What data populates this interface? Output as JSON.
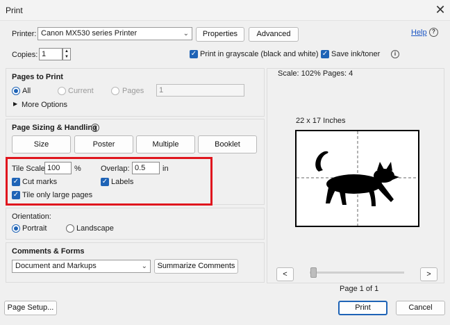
{
  "window": {
    "title": "Print"
  },
  "printer": {
    "label": "Printer:",
    "selected": "Canon MX530 series Printer",
    "properties": "Properties",
    "advanced": "Advanced",
    "help": "Help"
  },
  "copies": {
    "label": "Copies:",
    "value": "1",
    "grayscale": "Print in grayscale (black and white)",
    "save_ink": "Save ink/toner"
  },
  "pages_to_print": {
    "heading": "Pages to Print",
    "all": "All",
    "current": "Current",
    "pages": "Pages",
    "pages_value": "1",
    "more_options": "More Options"
  },
  "sizing": {
    "heading": "Page Sizing & Handling",
    "tabs": [
      "Size",
      "Poster",
      "Multiple",
      "Booklet"
    ],
    "tile_scale_label": "Tile Scale:",
    "tile_scale_value": "100",
    "tile_scale_unit": "%",
    "overlap_label": "Overlap:",
    "overlap_value": "0.5",
    "overlap_unit": "in",
    "cut_marks": "Cut marks",
    "labels": "Labels",
    "tile_large": "Tile only large pages"
  },
  "orientation": {
    "heading": "Orientation:",
    "portrait": "Portrait",
    "landscape": "Landscape"
  },
  "comments": {
    "heading": "Comments & Forms",
    "selected": "Document and Markups",
    "summarize": "Summarize Comments"
  },
  "preview": {
    "scale_text": "Scale: 102% Pages: 4",
    "size_text": "22 x 17 Inches",
    "page_indicator": "Page 1 of 1",
    "prev": "<",
    "next": ">",
    "slider_position": 0
  },
  "footer": {
    "page_setup": "Page Setup...",
    "print": "Print",
    "cancel": "Cancel"
  },
  "colors": {
    "accent": "#1e63b6",
    "highlight": "#e0161e"
  }
}
